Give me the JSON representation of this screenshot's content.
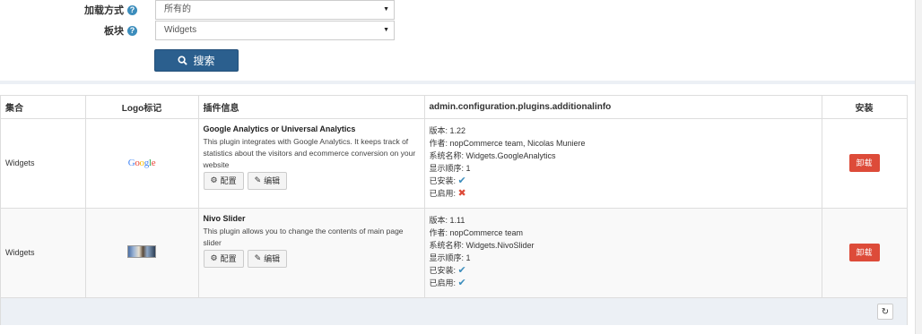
{
  "search": {
    "load_mode": {
      "label": "加载方式",
      "help": "?",
      "value": "所有的"
    },
    "group": {
      "label": "板块",
      "help": "?",
      "value": "Widgets"
    },
    "search_button": "搜索"
  },
  "grid": {
    "headers": [
      "集合",
      "Logo标记",
      "插件信息",
      "admin.configuration.plugins.additionalinfo",
      "安装"
    ],
    "rows": [
      {
        "group": "Widgets",
        "logo_text": "Google",
        "name": "Google Analytics or Universal Analytics",
        "description": "This plugin integrates with Google Analytics. It keeps track of statistics about the visitors and ecommerce conversion on your website",
        "configure_label": "配置",
        "edit_label": "编辑",
        "version": "版本: 1.22",
        "author": "作者: nopCommerce team, Nicolas Muniere",
        "system_name": "系统名称: Widgets.GoogleAnalytics",
        "display_order": "显示顺序: 1",
        "installed_label": "已安装:",
        "enabled_label": "已启用:",
        "installed": true,
        "enabled": false,
        "uninstall_label": "卸载"
      },
      {
        "group": "Widgets",
        "name": "Nivo Slider",
        "description": "This plugin allows you to change the contents of main page slider",
        "configure_label": "配置",
        "edit_label": "编辑",
        "version": "版本: 1.11",
        "author": "作者: nopCommerce team",
        "system_name": "系统名称: Widgets.NivoSlider",
        "display_order": "显示顺序: 1",
        "installed_label": "已安装:",
        "enabled_label": "已启用:",
        "installed": true,
        "enabled": true,
        "uninstall_label": "卸载"
      }
    ]
  },
  "icons": {
    "help": "help-icon",
    "search": "search-icon",
    "configure": "gear-icon",
    "edit": "pencil-icon",
    "check": "check-icon",
    "cross": "cross-icon",
    "refresh": "refresh-icon"
  },
  "colors": {
    "primary": "#2b5f8e",
    "danger": "#dd4b39",
    "info": "#3c8dbc",
    "panel_bg": "#ecf0f5"
  }
}
